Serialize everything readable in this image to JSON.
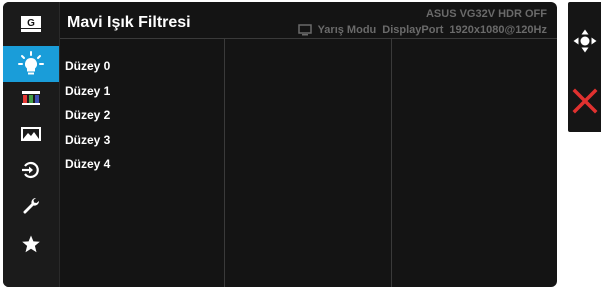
{
  "window": {
    "title": "Mavi Işık Filtresi",
    "model_status": "ASUS VG32V HDR OFF",
    "mode": "Yarış Modu",
    "input": "DisplayPort",
    "resolution": "1920x1080@120Hz"
  },
  "sidebar": {
    "items": [
      {
        "icon": "gameplus-icon",
        "label": "G"
      },
      {
        "icon": "blue-light-filter-icon",
        "active": true
      },
      {
        "icon": "color-icon"
      },
      {
        "icon": "image-icon"
      },
      {
        "icon": "input-select-icon"
      },
      {
        "icon": "system-setup-icon"
      },
      {
        "icon": "favorite-star-icon"
      }
    ]
  },
  "main": {
    "options": [
      {
        "label": "Düzey 0"
      },
      {
        "label": "Düzey 1"
      },
      {
        "label": "Düzey 2"
      },
      {
        "label": "Düzey 3"
      },
      {
        "label": "Düzey 4"
      }
    ]
  },
  "right_panel": {
    "items": [
      {
        "icon": "navigation-joystick-icon"
      },
      {
        "icon": "close-icon"
      }
    ]
  },
  "colors": {
    "active_accent": "#1a9dd9",
    "close_red": "#e0312f",
    "background": "#141414"
  }
}
